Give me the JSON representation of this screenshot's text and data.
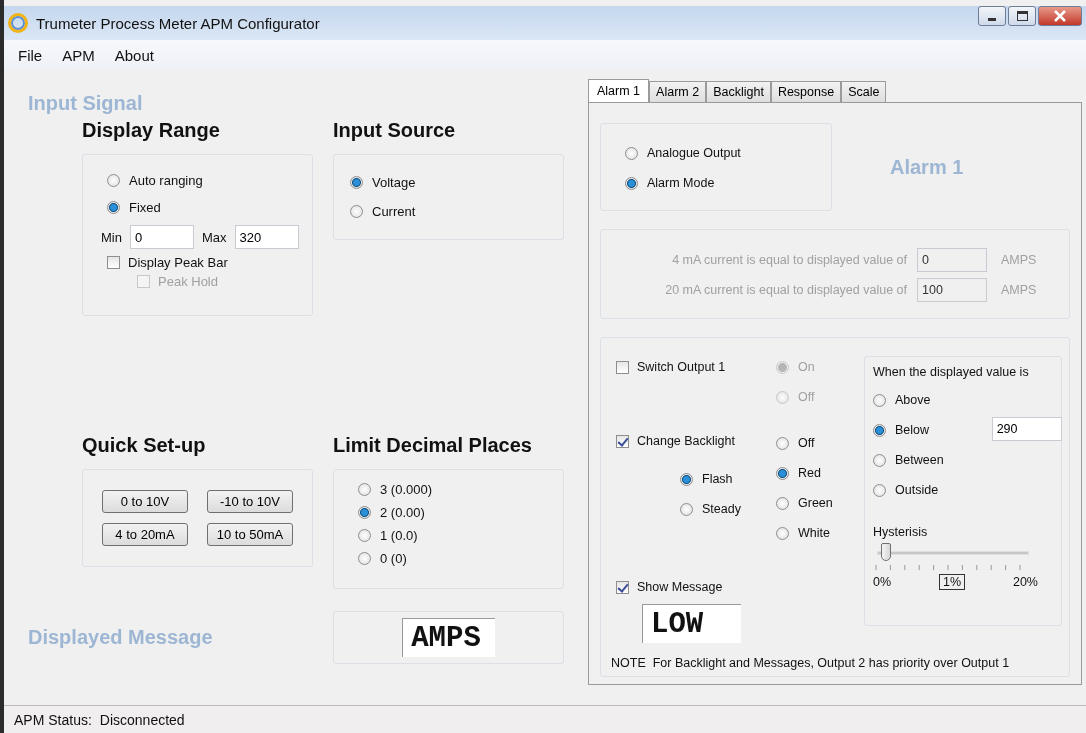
{
  "window": {
    "title": "Trumeter Process Meter APM Configurator"
  },
  "menu": [
    "File",
    "APM",
    "About"
  ],
  "input_signal_title": "Input Signal",
  "display_range": {
    "title": "Display Range",
    "options": [
      {
        "label": "Auto ranging",
        "selected": false
      },
      {
        "label": "Fixed",
        "selected": true
      }
    ],
    "min_label": "Min",
    "min": "0",
    "max_label": "Max",
    "max": "320",
    "peak_bar": {
      "label": "Display Peak Bar",
      "checked": false,
      "disabled": false
    },
    "peak_hold": {
      "label": "Peak Hold",
      "checked": false,
      "disabled": true
    }
  },
  "input_source": {
    "title": "Input Source",
    "options": [
      {
        "label": "Voltage",
        "selected": true
      },
      {
        "label": "Current",
        "selected": false
      }
    ]
  },
  "quick_setup": {
    "title": "Quick Set-up",
    "buttons": [
      "0 to 10V",
      "-10 to 10V",
      "4 to 20mA",
      "10 to 50mA"
    ]
  },
  "decimal_places": {
    "title": "Limit Decimal Places",
    "options": [
      {
        "label": "3 (0.000)",
        "selected": false
      },
      {
        "label": "2 (0.00)",
        "selected": true
      },
      {
        "label": "1 (0.0)",
        "selected": false
      },
      {
        "label": "0 (0)",
        "selected": false
      }
    ]
  },
  "displayed_message": {
    "label": "Displayed Message",
    "value": "AMPS"
  },
  "tabs": [
    {
      "label": "Alarm 1",
      "selected": true
    },
    {
      "label": "Alarm 2",
      "selected": false
    },
    {
      "label": "Backlight",
      "selected": false
    },
    {
      "label": "Response",
      "selected": false
    },
    {
      "label": "Scale",
      "selected": false
    }
  ],
  "alarm": {
    "title": "Alarm 1",
    "output_mode": [
      {
        "label": "Analogue Output",
        "selected": false
      },
      {
        "label": "Alarm Mode",
        "selected": true
      }
    ],
    "current_mapping": {
      "disabled": true,
      "rows": [
        {
          "label": "4 mA current is equal to displayed value of",
          "value": "0",
          "unit": "AMPS"
        },
        {
          "label": "20 mA current is equal to displayed value of",
          "value": "100",
          "unit": "AMPS"
        }
      ]
    },
    "switch_output": {
      "label": "Switch Output 1",
      "checked": false,
      "disabled": false
    },
    "switch_states": [
      {
        "label": "On",
        "selected": true,
        "disabled": true
      },
      {
        "label": "Off",
        "selected": false,
        "disabled": true
      }
    ],
    "change_backlight": {
      "label": "Change Backlight",
      "checked": true,
      "disabled": false
    },
    "backlight_modes": [
      {
        "label": "Flash",
        "selected": true,
        "disabled": false
      },
      {
        "label": "Steady",
        "selected": false,
        "disabled": false
      }
    ],
    "backlight_colors": [
      {
        "label": "Off",
        "selected": false,
        "disabled": false
      },
      {
        "label": "Red",
        "selected": true,
        "disabled": false
      },
      {
        "label": "Green",
        "selected": false,
        "disabled": false
      },
      {
        "label": "White",
        "selected": false,
        "disabled": false
      }
    ],
    "show_message": {
      "label": "Show Message",
      "checked": true,
      "disabled": false
    },
    "message": "LOW",
    "condition": {
      "title": "When the displayed value is",
      "options": [
        {
          "label": "Above",
          "selected": false
        },
        {
          "label": "Below",
          "selected": true
        },
        {
          "label": "Between",
          "selected": false
        },
        {
          "label": "Outside",
          "selected": false
        }
      ],
      "value": "290"
    },
    "hysteresis": {
      "label": "Hysterisis",
      "level": 0.05,
      "min": "0%",
      "value": "1%",
      "max": "20%"
    },
    "note": "NOTE  For Backlight and Messages, Output 2 has priority over Output 1"
  },
  "status_bar": {
    "label": "APM Status:",
    "value": "Disconnected"
  }
}
